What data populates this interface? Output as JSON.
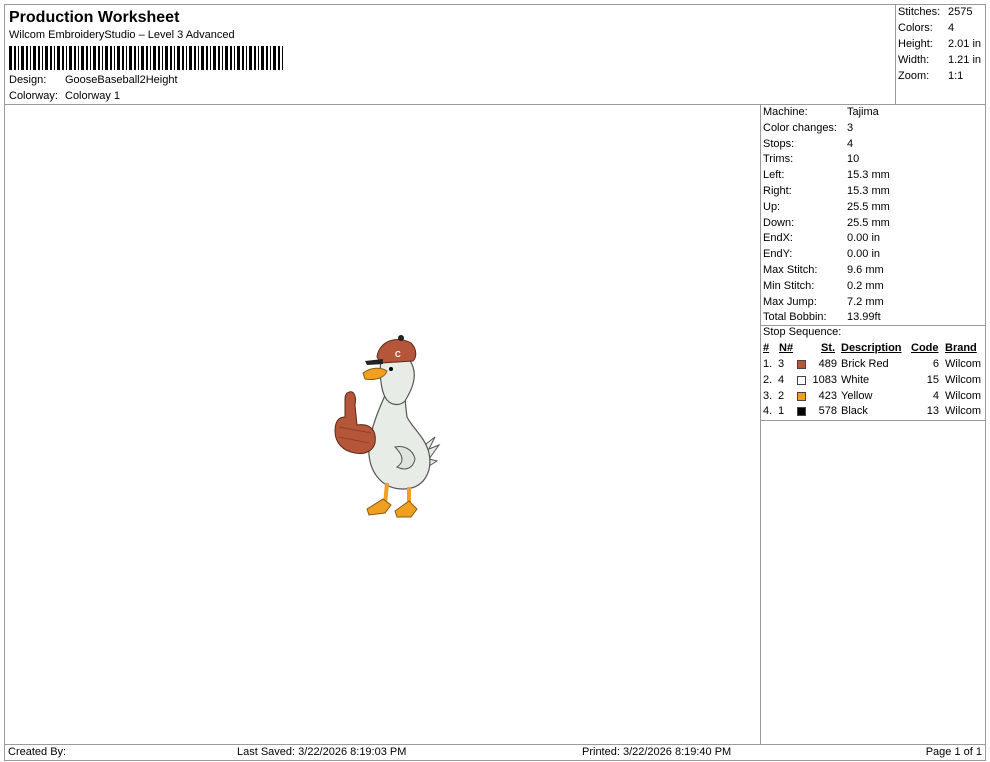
{
  "header": {
    "title": "Production Worksheet",
    "subtitle": "Wilcom EmbroideryStudio – Level 3 Advanced",
    "design_label": "Design:",
    "design_value": "GooseBaseball2Height",
    "colorway_label": "Colorway:",
    "colorway_value": "Colorway 1"
  },
  "summary": [
    {
      "label": "Stitches:",
      "value": "2575"
    },
    {
      "label": "Colors:",
      "value": "4"
    },
    {
      "label": "Height:",
      "value": "2.01 in"
    },
    {
      "label": "Width:",
      "value": "1.21 in"
    },
    {
      "label": "Zoom:",
      "value": "1:1"
    }
  ],
  "details": [
    {
      "label": "Machine:",
      "value": "Tajima"
    },
    {
      "label": "Color changes:",
      "value": "3"
    },
    {
      "label": "Stops:",
      "value": "4"
    },
    {
      "label": "Trims:",
      "value": "10"
    },
    {
      "label": "Left:",
      "value": "15.3 mm"
    },
    {
      "label": "Right:",
      "value": "15.3 mm"
    },
    {
      "label": "Up:",
      "value": "25.5 mm"
    },
    {
      "label": "Down:",
      "value": "25.5 mm"
    },
    {
      "label": "EndX:",
      "value": "0.00 in"
    },
    {
      "label": "EndY:",
      "value": "0.00 in"
    },
    {
      "label": "Max Stitch:",
      "value": "9.6 mm"
    },
    {
      "label": "Min Stitch:",
      "value": "0.2 mm"
    },
    {
      "label": "Max Jump:",
      "value": "7.2 mm"
    },
    {
      "label": "Total Bobbin:",
      "value": "13.99ft"
    }
  ],
  "stop_sequence": {
    "title": "Stop Sequence:",
    "headers": {
      "num": "#",
      "n": "N#",
      "st": "St.",
      "description": "Description",
      "code": "Code",
      "brand": "Brand"
    },
    "rows": [
      {
        "num": "1.",
        "n": "3",
        "color": "#b5553a",
        "st": "489",
        "description": "Brick Red",
        "code": "6",
        "brand": "Wilcom"
      },
      {
        "num": "2.",
        "n": "4",
        "color": "#ffffff",
        "st": "1083",
        "description": "White",
        "code": "15",
        "brand": "Wilcom"
      },
      {
        "num": "3.",
        "n": "2",
        "color": "#f0a020",
        "st": "423",
        "description": "Yellow",
        "code": "4",
        "brand": "Wilcom"
      },
      {
        "num": "4.",
        "n": "1",
        "color": "#000000",
        "st": "578",
        "description": "Black",
        "code": "13",
        "brand": "Wilcom"
      }
    ]
  },
  "footer": {
    "created_by": "Created By:",
    "last_saved": "Last Saved: 3/22/2026 8:19:03 PM",
    "printed": "Printed: 3/22/2026 8:19:40 PM",
    "page": "Page 1 of 1"
  },
  "colors": {
    "brick_red": "#b5553a",
    "white": "#ffffff",
    "yellow": "#f0a020",
    "black": "#000000",
    "goose_body": "#e8ece6"
  }
}
